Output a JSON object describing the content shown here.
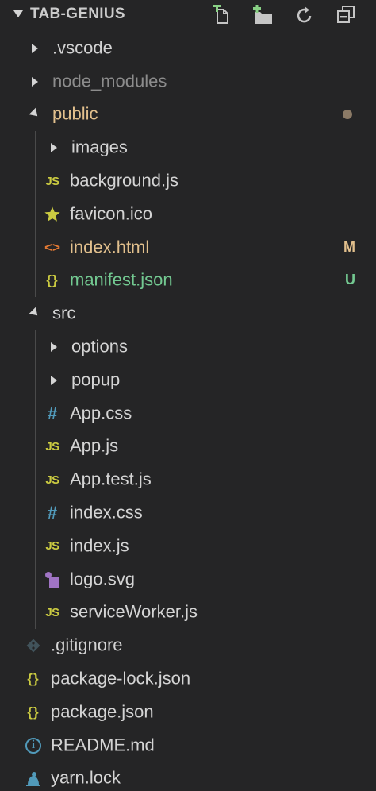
{
  "explorer": {
    "title": "TAB-GENIUS",
    "actions": [
      {
        "name": "new-file-icon"
      },
      {
        "name": "new-folder-icon"
      },
      {
        "name": "refresh-icon"
      },
      {
        "name": "collapse-all-icon"
      }
    ]
  },
  "colors": {
    "default": "#d4d4d4",
    "ignored": "#8c8c8c",
    "modified": "#e2c08d",
    "untracked": "#73c991",
    "modified_dot": "#8b7a66"
  },
  "tree": [
    {
      "label": ".vscode",
      "depth": 0,
      "kind": "folder",
      "expanded": false,
      "status": "default"
    },
    {
      "label": "node_modules",
      "depth": 0,
      "kind": "folder",
      "expanded": false,
      "status": "ignored"
    },
    {
      "label": "public",
      "depth": 0,
      "kind": "folder",
      "expanded": true,
      "status": "modified",
      "dot": true
    },
    {
      "label": "images",
      "depth": 1,
      "kind": "folder",
      "expanded": false,
      "status": "default"
    },
    {
      "label": "background.js",
      "depth": 1,
      "kind": "file",
      "icon": "js-icon",
      "icon_text": "JS",
      "status": "default"
    },
    {
      "label": "favicon.ico",
      "depth": 1,
      "kind": "file",
      "icon": "star-icon",
      "status": "default"
    },
    {
      "label": "index.html",
      "depth": 1,
      "kind": "file",
      "icon": "html-icon",
      "icon_text": "<>",
      "status": "modified",
      "badge": "M"
    },
    {
      "label": "manifest.json",
      "depth": 1,
      "kind": "file",
      "icon": "json-icon",
      "icon_text": "{}",
      "status": "untracked",
      "badge": "U"
    },
    {
      "label": "src",
      "depth": 0,
      "kind": "folder",
      "expanded": true,
      "status": "default"
    },
    {
      "label": "options",
      "depth": 1,
      "kind": "folder",
      "expanded": false,
      "status": "default"
    },
    {
      "label": "popup",
      "depth": 1,
      "kind": "folder",
      "expanded": false,
      "status": "default"
    },
    {
      "label": "App.css",
      "depth": 1,
      "kind": "file",
      "icon": "css-icon",
      "icon_text": "#",
      "status": "default"
    },
    {
      "label": "App.js",
      "depth": 1,
      "kind": "file",
      "icon": "js-icon",
      "icon_text": "JS",
      "status": "default"
    },
    {
      "label": "App.test.js",
      "depth": 1,
      "kind": "file",
      "icon": "js-icon",
      "icon_text": "JS",
      "status": "default"
    },
    {
      "label": "index.css",
      "depth": 1,
      "kind": "file",
      "icon": "css-icon",
      "icon_text": "#",
      "status": "default"
    },
    {
      "label": "index.js",
      "depth": 1,
      "kind": "file",
      "icon": "js-icon",
      "icon_text": "JS",
      "status": "default"
    },
    {
      "label": "logo.svg",
      "depth": 1,
      "kind": "file",
      "icon": "svg-icon",
      "status": "default"
    },
    {
      "label": "serviceWorker.js",
      "depth": 1,
      "kind": "file",
      "icon": "js-icon",
      "icon_text": "JS",
      "status": "default"
    },
    {
      "label": ".gitignore",
      "depth": 0,
      "kind": "file",
      "icon": "git-icon",
      "status": "default"
    },
    {
      "label": "package-lock.json",
      "depth": 0,
      "kind": "file",
      "icon": "json-icon",
      "icon_text": "{}",
      "status": "default"
    },
    {
      "label": "package.json",
      "depth": 0,
      "kind": "file",
      "icon": "json-icon",
      "icon_text": "{}",
      "status": "default"
    },
    {
      "label": "README.md",
      "depth": 0,
      "kind": "file",
      "icon": "info-icon",
      "icon_text": "i",
      "status": "default"
    },
    {
      "label": "yarn.lock",
      "depth": 0,
      "kind": "file",
      "icon": "yarn-icon",
      "status": "default"
    }
  ]
}
